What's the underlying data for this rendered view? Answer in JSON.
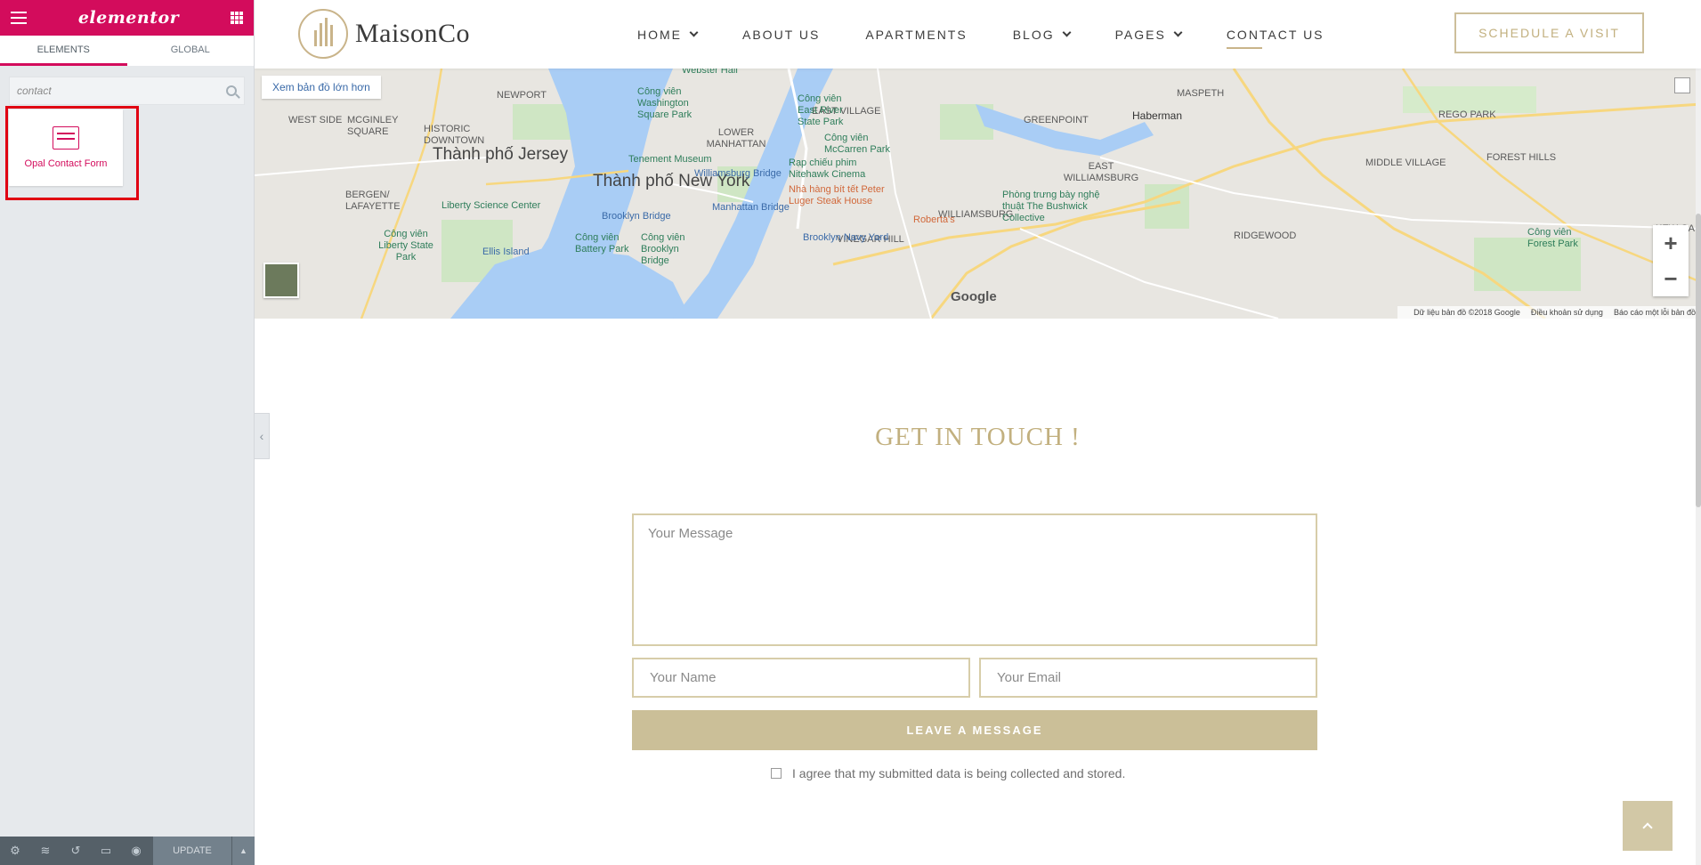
{
  "panel": {
    "brand": "elementor",
    "tabs": [
      {
        "label": "ELEMENTS",
        "active": true
      },
      {
        "label": "GLOBAL",
        "active": false
      }
    ],
    "search": {
      "value": "",
      "placeholder": "contact"
    },
    "widget": {
      "label": "Opal Contact Form"
    },
    "footer": {
      "update_label": "UPDATE"
    }
  },
  "site": {
    "logo_text": "MaisonCo",
    "nav": [
      {
        "label": "HOME",
        "dropdown": true,
        "active": false
      },
      {
        "label": "ABOUT US",
        "dropdown": false,
        "active": false
      },
      {
        "label": "APARTMENTS",
        "dropdown": false,
        "active": false
      },
      {
        "label": "BLOG",
        "dropdown": true,
        "active": false
      },
      {
        "label": "PAGES",
        "dropdown": true,
        "active": false
      },
      {
        "label": "CONTACT US",
        "dropdown": false,
        "active": true
      }
    ],
    "cta_label": "SCHEDULE A VISIT",
    "accent_color": "#c2b07f"
  },
  "map": {
    "larger_map_link": "Xem bản đồ lớn hơn",
    "districts": [
      "WEST SIDE",
      "MCGINLEY SQUARE",
      "HISTORIC DOWNTOWN",
      "NEWPORT",
      "BERGEN/ LAFAYETTE",
      "LOWER MANHATTAN",
      "EAST VILLAGE",
      "GREENPOINT",
      "EAST WILLIAMSBURG",
      "WILLIAMSBURG",
      "MASPETH",
      "REGO PARK",
      "MIDDLE VILLAGE",
      "FOREST HILLS",
      "RIDGEWOOD",
      "VINEGAR HILL",
      "KEW GA"
    ],
    "cities": [
      "Thành phố Jersey",
      "Thành phố New York"
    ],
    "pois": [
      "Webster Hall",
      "Công viên Washington Square Park",
      "Công viên East River State Park",
      "Công viên McCarren Park",
      "Rạp chiếu phim Nitehawk Cinema",
      "Tenement Museum",
      "Williamsburg Bridge",
      "Nhà hàng bít tết Peter Luger Steak House",
      "Roberta's",
      "Phòng trưng bày nghệ thuật The Bushwick Collective",
      "Liberty Science Center",
      "Brooklyn Bridge",
      "Manhattan Bridge",
      "Brooklyn Navy Yard",
      "Ellis Island",
      "Công viên Liberty State Park",
      "Công viên Battery Park",
      "Công viên Brooklyn Bridge",
      "Haberman",
      "Công viên Forest Park"
    ],
    "google_logo": "Google",
    "attribution": [
      "Dữ liệu bản đồ ©2018 Google",
      "Điều khoản sử dụng",
      "Báo cáo một lỗi bản đồ"
    ]
  },
  "contact": {
    "title": "GET IN TOUCH !",
    "message_placeholder": "Your Message",
    "name_placeholder": "Your Name",
    "email_placeholder": "Your Email",
    "submit_label": "LEAVE A MESSAGE",
    "consent_label": "I agree that my submitted data is being collected and stored.",
    "consent_checked": false
  }
}
